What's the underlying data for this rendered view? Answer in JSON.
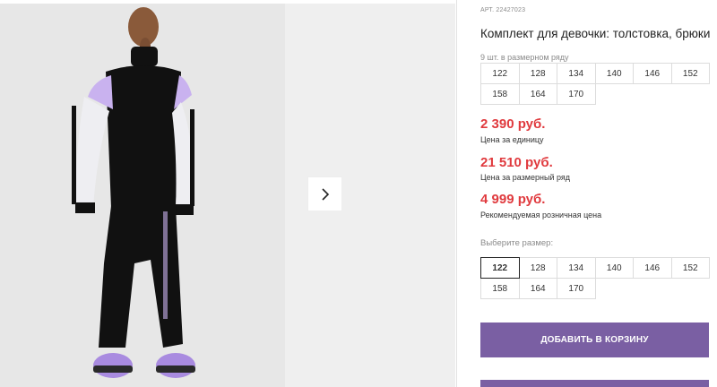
{
  "gallery": {
    "next_arrow": "chevron-right-icon"
  },
  "product": {
    "article": "АРТ. 22427023",
    "title": "Комплект для девочки: толстовка, брюки",
    "row_label": "9 шт. в размерном ряду",
    "row_sizes": [
      "122",
      "128",
      "134",
      "140",
      "146",
      "152",
      "158",
      "164",
      "170"
    ],
    "prices": [
      {
        "value": "2 390 руб.",
        "caption": "Цена за единицу"
      },
      {
        "value": "21 510 руб.",
        "caption": "Цена за размерный ряд"
      },
      {
        "value": "4 999 руб.",
        "caption": "Рекомендуемая розничная цена"
      }
    ],
    "choose_label": "Выберите размер:",
    "choose_sizes": [
      "122",
      "128",
      "134",
      "140",
      "146",
      "152",
      "158",
      "164",
      "170"
    ],
    "selected_size": "122",
    "add_to_cart": "ДОБАВИТЬ В КОРЗИНУ"
  },
  "colors": {
    "price": "#e03a3e",
    "button": "#7a5fa3"
  }
}
